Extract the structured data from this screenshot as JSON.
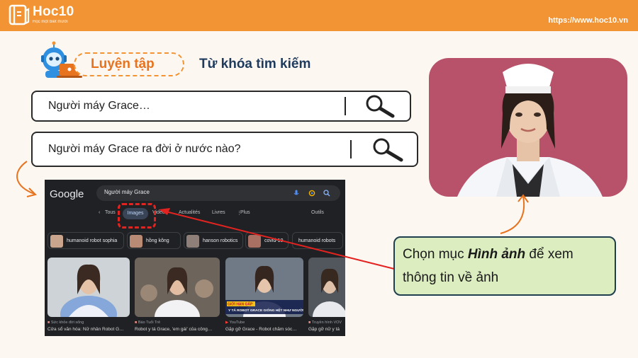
{
  "header": {
    "logo_text": "Hoc10",
    "logo_sub": "Học một biết mười",
    "url": "https://www.hoc10.vn"
  },
  "section": {
    "label": "Luyện tập",
    "title": "Từ khóa tìm kiếm"
  },
  "search_boxes": [
    {
      "query": "Người máy Grace…"
    },
    {
      "query": "Người máy Grace ra đời ở nước nào?"
    }
  ],
  "google": {
    "logo": "Google",
    "query": "Người máy Grace",
    "tabs": {
      "all": "Tous",
      "images": "Images",
      "videos": "Vidéos",
      "news": "Actualités",
      "books": "Livres",
      "more": "Plus",
      "tools": "Outils"
    },
    "chips": [
      {
        "label": "humanoid robot sophia"
      },
      {
        "label": "hồng kông"
      },
      {
        "label": "hanson robotics"
      },
      {
        "label": "covid-19"
      },
      {
        "label": "humanoid robots"
      }
    ],
    "results": [
      {
        "source": "Sức khỏe đời sống",
        "caption": "Cửa sổ văn hóa: Nữ nhân Robot G…"
      },
      {
        "source": "Báo Tuổi Trẻ",
        "caption": "Robot y tá Grace, 'em gái' của công…"
      },
      {
        "source": "YouTube",
        "caption": "Gặp gỡ Grace - Robot chăm sóc…",
        "banner_top": "GIỚI HẠN GẤP",
        "banner": "Y TÁ ROBOT GRACE GIỐNG HỆT NHƯ NGƯỜI THẬT"
      },
      {
        "source": "Truyền hình VOV",
        "caption": "Gặp gỡ nữ y tá"
      }
    ]
  },
  "callout": {
    "prefix": "Chọn mục ",
    "highlight": "Hình ảnh",
    "suffix": " để xem thông tin về ảnh"
  },
  "colors": {
    "header_orange": "#f29433",
    "title_navy": "#1e3a5c",
    "callout_green": "#dcedc0",
    "photo_bg": "#b8526a",
    "annotation_red": "#e32320"
  }
}
